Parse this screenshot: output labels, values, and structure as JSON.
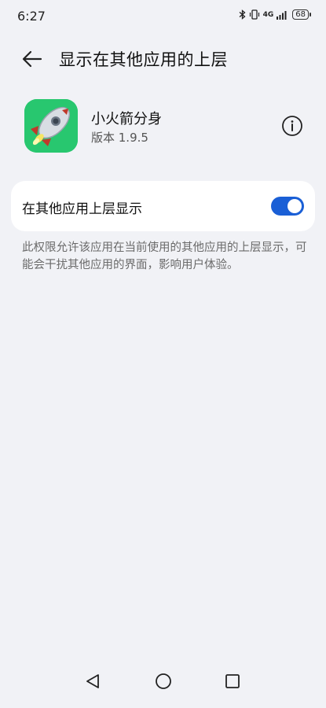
{
  "status_bar": {
    "time": "6:27",
    "network": "4G",
    "battery": "68",
    "icons": [
      "bluetooth-icon",
      "vibrate-icon",
      "signal-icon",
      "battery-icon"
    ]
  },
  "header": {
    "title": "显示在其他应用的上层",
    "back_icon": "arrow-left-icon"
  },
  "app": {
    "name": "小火箭分身",
    "version": "版本 1.9.5",
    "icon": "rocket-icon",
    "icon_bg": "#28c76f",
    "info_icon": "info-icon"
  },
  "permission": {
    "label": "在其他应用上层显示",
    "enabled": true,
    "toggle_color": "#1a5fd6"
  },
  "description": "此权限允许该应用在当前使用的其他应用的上层显示，可能会干扰其他应用的界面，影响用户体验。",
  "nav": {
    "icons": [
      "nav-back-icon",
      "nav-home-icon",
      "nav-recents-icon"
    ]
  }
}
